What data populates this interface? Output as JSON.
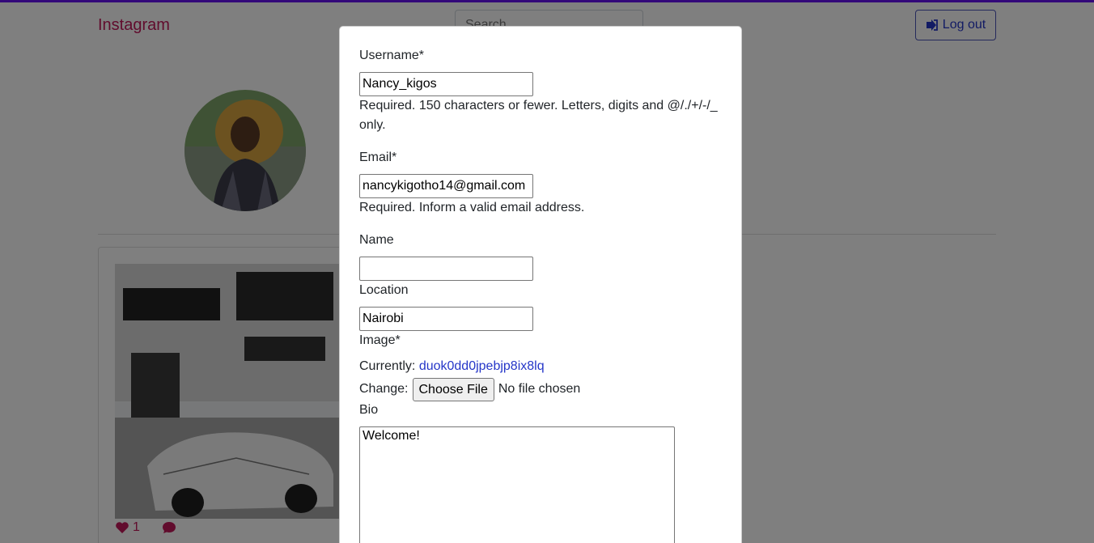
{
  "navbar": {
    "brand": "Instagram",
    "search_placeholder": "Search",
    "logout_label": "Log out"
  },
  "posts": [
    {
      "likes": "1"
    }
  ],
  "edit_form": {
    "username": {
      "label": "Username*",
      "value": "Nancy_kigos",
      "help": "Required. 150 characters or fewer. Letters, digits and @/./+/-/_ only."
    },
    "email": {
      "label": "Email*",
      "value": "nancykigotho14@gmail.com",
      "help": "Required. Inform a valid email address."
    },
    "name": {
      "label": "Name",
      "value": ""
    },
    "location": {
      "label": "Location",
      "value": "Nairobi"
    },
    "image": {
      "label": "Image*",
      "currently_label": "Currently:",
      "current_file": "duok0dd0jpebjp8ix8lq",
      "change_label": "Change:",
      "choose_button": "Choose File",
      "no_file": "No file chosen"
    },
    "bio": {
      "label": "Bio",
      "value": "Welcome!"
    }
  },
  "colors": {
    "accent": "#6610f2",
    "brand": "#c2185b",
    "link": "#2536c8"
  }
}
